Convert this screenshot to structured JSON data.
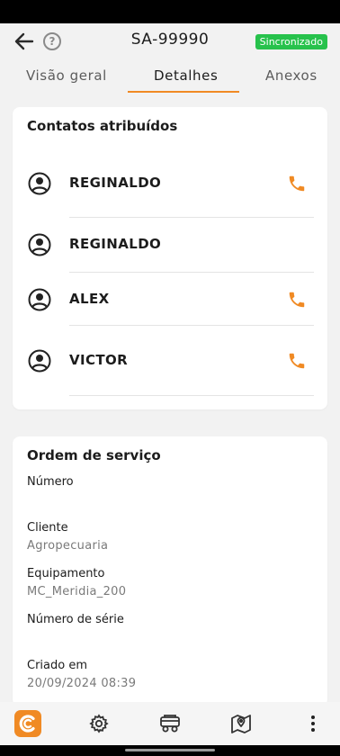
{
  "header": {
    "title": "SA-99990",
    "sync_badge": "Sincronizado",
    "help_label": "?"
  },
  "tabs": [
    {
      "label": "Visão geral"
    },
    {
      "label": "Detalhes"
    },
    {
      "label": "Anexos"
    }
  ],
  "active_tab": "Detalhes",
  "contacts": {
    "title": "Contatos atribuídos",
    "items": [
      {
        "name": "REGINALDO",
        "has_phone": true
      },
      {
        "name": "REGINALDO",
        "has_phone": false
      },
      {
        "name": "ALEX",
        "has_phone": true
      },
      {
        "name": "VICTOR",
        "has_phone": true
      }
    ]
  },
  "service_order": {
    "title": "Ordem de serviço",
    "fields": [
      {
        "label": "Número",
        "value": ""
      },
      {
        "label": "Cliente",
        "value": "Agropecuaria"
      },
      {
        "label": "Equipamento",
        "value": "MC_Meridia_200"
      },
      {
        "label": "Número de série",
        "value": ""
      },
      {
        "label": "Criado em",
        "value": "20/09/2024 08:39"
      }
    ]
  },
  "bottom_nav": [
    "logo-icon",
    "settings-gear-icon",
    "vehicle-icon",
    "map-pin-icon",
    "more-vertical-icon"
  ],
  "colors": {
    "accent": "#f08a24",
    "sync_badge": "#27c24c",
    "background": "#f2f2f2",
    "card": "#ffffff"
  }
}
